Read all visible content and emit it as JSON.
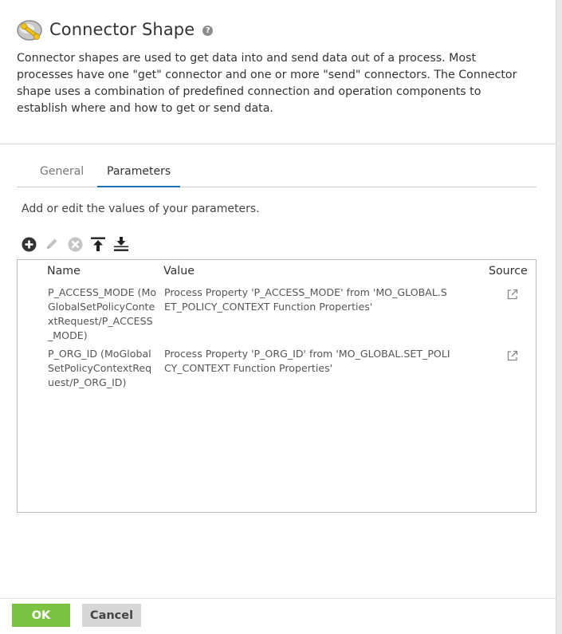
{
  "header": {
    "title": "Connector Shape",
    "help_icon": "?",
    "description": "Connector shapes are used to get data into and send data out of a process. Most processes have one \"get\" connector and one or more \"send\" connectors. The Connector shape uses a combination of predefined connection and operation components to establish where and how to get or send data."
  },
  "tabs": [
    {
      "label": "General",
      "active": false
    },
    {
      "label": "Parameters",
      "active": true
    }
  ],
  "instructions": "Add or edit the values of your parameters.",
  "toolbar": {
    "icons": [
      "add-icon",
      "edit-icon",
      "delete-icon",
      "move-to-top-icon",
      "move-to-bottom-icon"
    ]
  },
  "table": {
    "columns": [
      "Name",
      "Value",
      "Source"
    ],
    "rows": [
      {
        "name": "P_ACCESS_MODE (MoGlobalSetPolicyContextRequest/P_ACCESS_MODE)",
        "value": "Process Property 'P_ACCESS_MODE' from 'MO_GLOBAL.SET_POLICY_CONTEXT Function Properties'",
        "source_icon": "external-link-icon"
      },
      {
        "name": "P_ORG_ID (MoGlobalSetPolicyContextRequest/P_ORG_ID)",
        "value": "Process Property 'P_ORG_ID' from 'MO_GLOBAL.SET_POLICY_CONTEXT Function Properties'",
        "source_icon": "external-link-icon"
      }
    ]
  },
  "footer": {
    "ok_label": "OK",
    "cancel_label": "Cancel"
  },
  "colors": {
    "ok": "#7bc242",
    "cancel": "#d7d7d7",
    "tab_underline": "#1a76b3"
  }
}
